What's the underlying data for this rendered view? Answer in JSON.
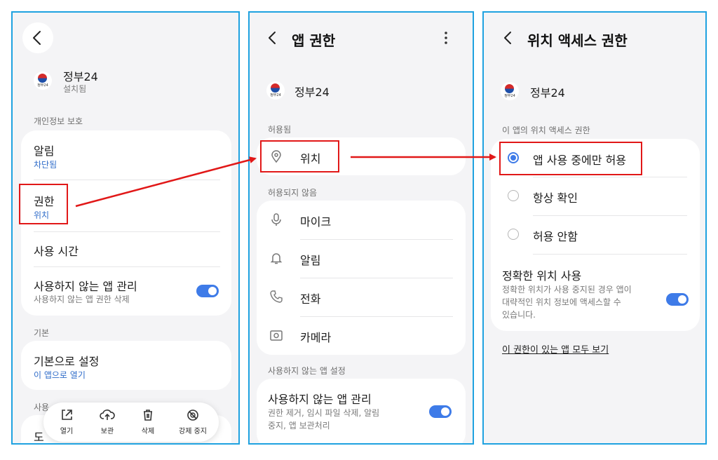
{
  "screen1": {
    "app_name": "정부24",
    "app_status": "설치됨",
    "logo_text": "정부24",
    "section_privacy": "개인정보 보호",
    "notifications": {
      "label": "알림",
      "value": "차단됨"
    },
    "permissions": {
      "label": "권한",
      "value": "위치"
    },
    "usage_time": "사용 시간",
    "unused_apps": {
      "label": "사용하지 않는 앱 관리",
      "desc": "사용하지 않는 앱 권한 삭제",
      "enabled": true
    },
    "section_default": "기본",
    "set_default": {
      "label": "기본으로 설정",
      "value": "이 앱으로 열기"
    },
    "section_partial": "사용",
    "partial_row": "도",
    "bottom_bar": {
      "open": "열기",
      "archive": "보관",
      "delete": "삭제",
      "force_stop": "강제 중지"
    }
  },
  "screen2": {
    "title": "앱 권한",
    "app_name": "정부24",
    "section_allowed": "허용됨",
    "allowed": [
      "위치"
    ],
    "section_not_allowed": "허용되지 않음",
    "not_allowed": [
      "마이크",
      "알림",
      "전화",
      "카메라"
    ],
    "section_unused": "사용하지 않는 앱 설정",
    "unused_apps": {
      "label": "사용하지 않는 앱 관리",
      "desc_line1": "권한 제거, 임시 파일 삭제, 알림",
      "desc_line2": "중지, 앱 보관처리",
      "enabled": true
    }
  },
  "screen3": {
    "title": "위치 액세스 권한",
    "app_name": "정부24",
    "section": "이 앱의 위치 액세스 권한",
    "options": [
      "앱 사용 중에만 허용",
      "항상 확인",
      "허용 안함"
    ],
    "selected_index": 0,
    "precise": {
      "label": "정확한 위치 사용",
      "desc_line1": "정확한 위치가 사용 중지된 경우 앱이",
      "desc_line2": "대략적인 위치 정보에 액세스할 수",
      "desc_line3": "있습니다.",
      "enabled": true
    },
    "see_all_link": "이 권한이 있는 앱 모두 보기"
  },
  "colors": {
    "accent": "#3e7be8",
    "highlight": "#e11818",
    "frame": "#1fa2e0"
  }
}
